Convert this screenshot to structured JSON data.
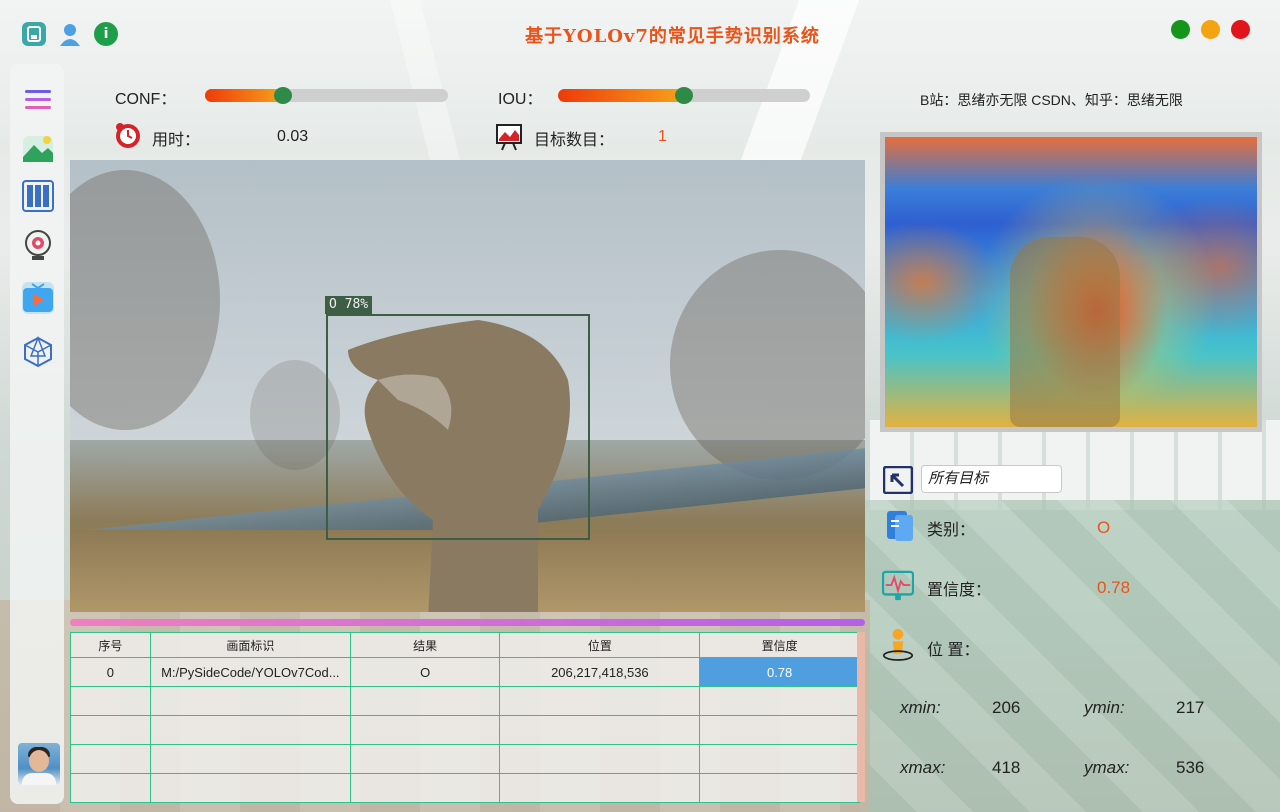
{
  "app": {
    "title": "基于YOLOv7的常见手势识别系统",
    "credit": "B站：思绪亦无限  CSDN、知乎：思绪无限"
  },
  "window_controls": [
    "maximize-green",
    "minimize-yellow",
    "close-red"
  ],
  "top_icons": [
    {
      "name": "save-icon",
      "color": "#3aa8a8"
    },
    {
      "name": "user-icon",
      "color": "#4d9fe6"
    },
    {
      "name": "info-icon",
      "color": "#1f9e4a"
    }
  ],
  "sidebar": {
    "items": [
      {
        "name": "menu-icon"
      },
      {
        "name": "image-icon"
      },
      {
        "name": "folder-icon"
      },
      {
        "name": "camera-icon"
      },
      {
        "name": "video-icon",
        "active": true
      },
      {
        "name": "model-icon"
      }
    ]
  },
  "controls": {
    "conf_label": "CONF：",
    "conf_value": 0.32,
    "iou_label": "IOU：",
    "iou_value": 0.5,
    "time_label": "用时：",
    "time_value": "0.03",
    "count_label": "目标数目：",
    "count_value": "1"
  },
  "detection": {
    "label": "O  78%"
  },
  "table": {
    "headers": [
      "序号",
      "画面标识",
      "结果",
      "位置",
      "置信度"
    ],
    "rows": [
      [
        "0",
        "M:/PySideCode/YOLOv7Cod...",
        "O",
        "206,217,418,536",
        "0.78"
      ],
      [
        "",
        "",
        "",
        "",
        ""
      ],
      [
        "",
        "",
        "",
        "",
        ""
      ],
      [
        "",
        "",
        "",
        "",
        ""
      ],
      [
        "",
        "",
        "",
        "",
        ""
      ]
    ]
  },
  "right_panel": {
    "target_select": "所有目标",
    "class_label": "类别：",
    "class_value": "O",
    "conf_label": "置信度：",
    "conf_value": "0.78",
    "position_label": "位 置：",
    "xmin_label": "xmin:",
    "xmin": "206",
    "ymin_label": "ymin:",
    "ymin": "217",
    "xmax_label": "xmax:",
    "xmax": "418",
    "ymax_label": "ymax:",
    "ymax": "536"
  },
  "colors": {
    "accent": "#e8541a",
    "table_border": "#30c28c",
    "selected_cell": "#4e9ee0",
    "slider_knob": "#2f8a47"
  }
}
